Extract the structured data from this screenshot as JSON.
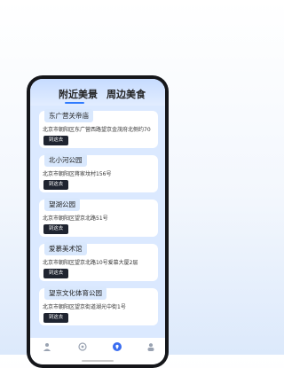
{
  "promo": {
    "title": "",
    "subtitle": ""
  },
  "tabs": [
    {
      "label": "附近美景",
      "active": true
    },
    {
      "label": "周边美食",
      "active": false
    }
  ],
  "places": [
    {
      "name": "东广营关帝庙",
      "address": "北京市朝阳区东广营西路望京金茂府北侧约70",
      "button": "到这去"
    },
    {
      "name": "北小河公园",
      "address": "北京市朝阳区蒋家坟村156号",
      "button": "到这去"
    },
    {
      "name": "望湖公园",
      "address": "北京市朝阳区望京北路51号",
      "button": "到这去"
    },
    {
      "name": "爱慕美术馆",
      "address": "北京市朝阳区望京北路10号爱慕大厦2层",
      "button": "到这去"
    },
    {
      "name": "望京文化体育公园",
      "address": "北京市朝阳区望京街道湖光中街1号",
      "button": "到这去"
    }
  ],
  "bottom_nav": [
    "person-icon",
    "compass-icon",
    "location-icon",
    "profile-icon"
  ],
  "colors": {
    "accent": "#2f7bff",
    "button": "#1f2430",
    "tab_bg": "#c6dbff"
  }
}
